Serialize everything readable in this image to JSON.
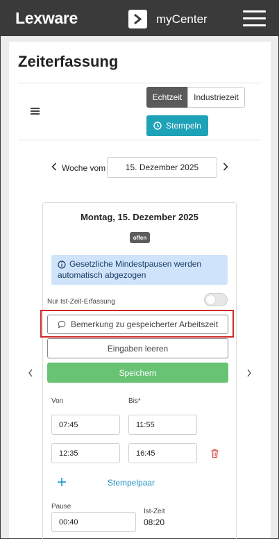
{
  "header": {
    "logo": "Lexware",
    "app_name": "myCenter"
  },
  "page": {
    "title": "Zeiterfassung"
  },
  "toolbar": {
    "mode_active": "Echtzeit",
    "mode_inactive": "Industriezeit",
    "stempeln_label": "Stempeln"
  },
  "week": {
    "label": "Woche vom",
    "date": "15. Dezember 2025"
  },
  "day": {
    "title": "Montag, 15. Dezember 2025",
    "status": "offen",
    "info": "Gesetzliche Mindestpausen werden automatisch abgezogen",
    "toggle_label": "Nur Ist-Zeit-Erfassung",
    "remark_button": "Bemerkung zu gespeicherter Arbeitszeit",
    "clear_button": "Eingaben leeren",
    "save_button": "Speichern",
    "von_label": "Von",
    "bis_label": "Bis",
    "required_mark": "*",
    "rows": [
      {
        "von": "07:45",
        "bis": "11:55"
      },
      {
        "von": "12:35",
        "bis": "16:45"
      }
    ],
    "add_label": "Stempelpaar",
    "pause_label": "Pause",
    "pause_value": "00:40",
    "ist_label": "Ist-Zeit",
    "ist_value": "08:20"
  },
  "colors": {
    "header_bg": "#3a3a3a",
    "teal": "#1ea2b7",
    "green": "#68c375",
    "info_bg": "#cfe4fb",
    "highlight": "#cf2a2a",
    "danger": "#d9534f"
  }
}
